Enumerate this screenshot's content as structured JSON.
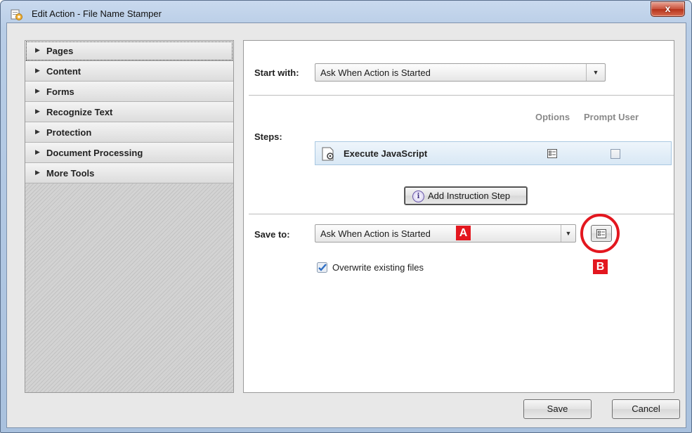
{
  "window": {
    "title": "Edit Action - File Name Stamper",
    "close_label": "x"
  },
  "sidebar": {
    "items": [
      {
        "label": "Pages"
      },
      {
        "label": "Content"
      },
      {
        "label": "Forms"
      },
      {
        "label": "Recognize Text"
      },
      {
        "label": "Protection"
      },
      {
        "label": "Document Processing"
      },
      {
        "label": "More Tools"
      }
    ]
  },
  "start_with": {
    "label": "Start with:",
    "value": "Ask When Action is Started"
  },
  "steps": {
    "label": "Steps:",
    "options_header": "Options",
    "prompt_header": "Prompt User",
    "items": [
      {
        "name": "Execute JavaScript",
        "prompt_user": false
      }
    ],
    "add_button": "Add Instruction Step"
  },
  "save_to": {
    "label": "Save to:",
    "value": "Ask When Action is Started"
  },
  "overwrite": {
    "label": "Overwrite existing files",
    "checked": true
  },
  "annotations": {
    "a": "A",
    "b": "B",
    "color": "#e3171f"
  },
  "footer": {
    "save": "Save",
    "cancel": "Cancel"
  }
}
